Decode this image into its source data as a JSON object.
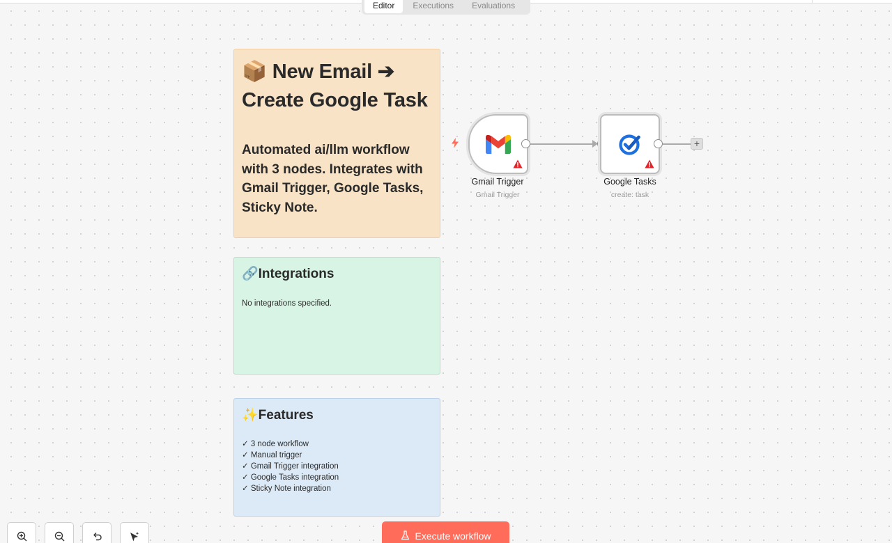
{
  "tabs": [
    {
      "label": "Editor",
      "active": true
    },
    {
      "label": "Executions",
      "active": false
    },
    {
      "label": "Evaluations",
      "active": false
    }
  ],
  "sticky_main": {
    "title_line1": "📦 New Email ➔",
    "title_line2": "Create Google Task",
    "description": "Automated ai/llm workflow with 3 nodes. Integrates with Gmail Trigger, Google Tasks, Sticky Note."
  },
  "sticky_integrations": {
    "title": "🔗Integrations",
    "body": "No integrations specified."
  },
  "sticky_features": {
    "title": "✨Features",
    "items": [
      "✓ 3 node workflow",
      "✓ Manual trigger",
      "✓ Gmail Trigger integration",
      "✓ Google Tasks integration",
      "✓ Sticky Note integration"
    ]
  },
  "nodes": [
    {
      "name": "Gmail Trigger",
      "subtitle": "Gmail Trigger",
      "icon": "gmail-icon"
    },
    {
      "name": "Google Tasks",
      "subtitle": "create: task",
      "icon": "google-tasks-icon"
    }
  ],
  "add_node_label": "+",
  "execute_button": {
    "label": "Execute workflow",
    "icon": "flask-icon"
  },
  "controls": [
    "zoom-in-icon",
    "zoom-out-icon",
    "undo-icon",
    "tidy-up-icon"
  ],
  "colors": {
    "accent": "#ff6d5a",
    "sticky_orange": "#f9e3c6",
    "sticky_green": "#d8f4e4",
    "sticky_blue": "#dceaf7",
    "warning": "#e0252b"
  }
}
